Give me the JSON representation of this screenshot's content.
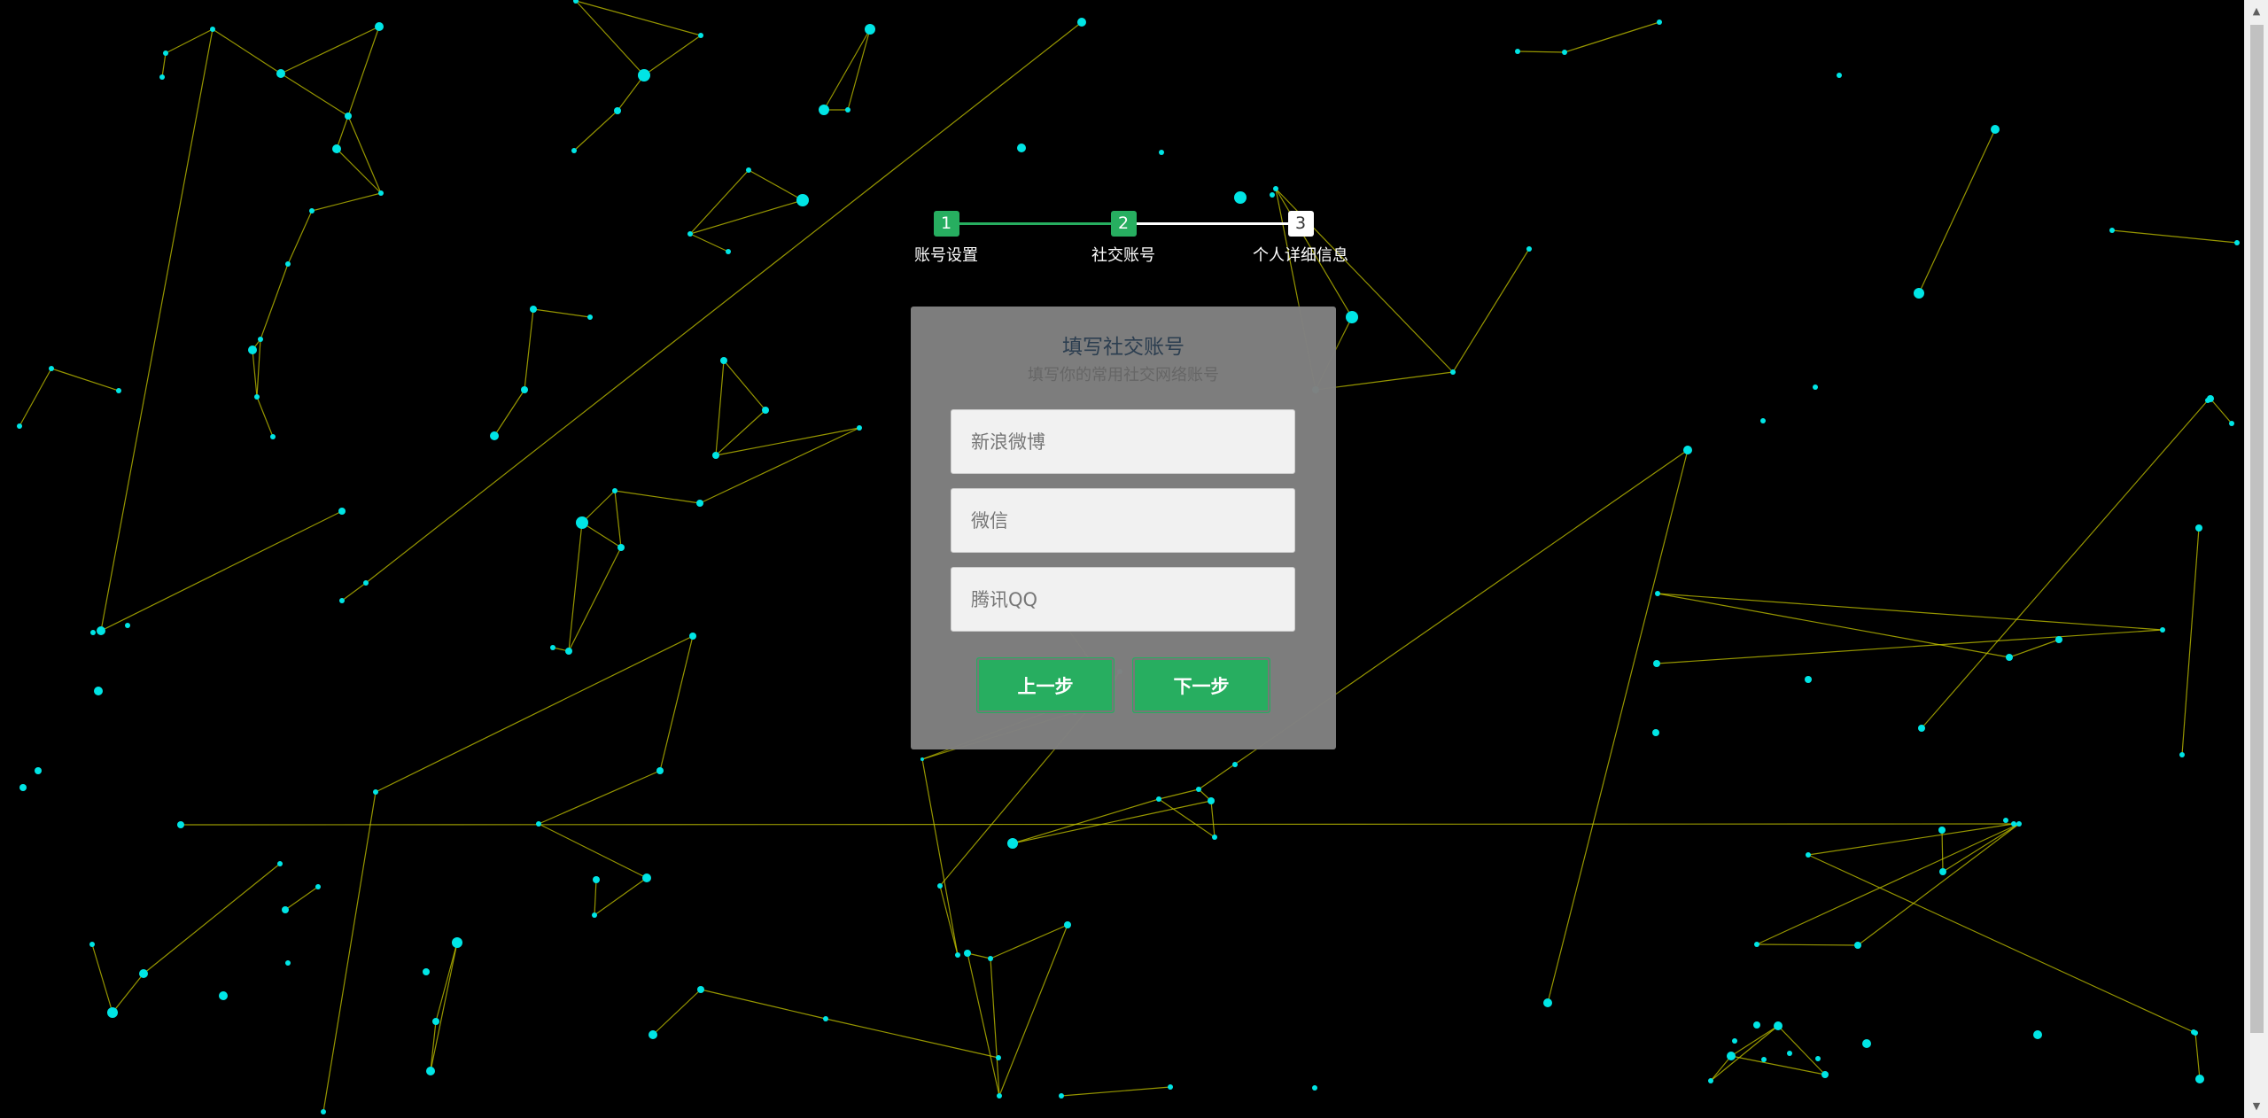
{
  "progress": {
    "steps": [
      {
        "number": "1",
        "label": "账号设置",
        "state": "active"
      },
      {
        "number": "2",
        "label": "社交账号",
        "state": "active"
      },
      {
        "number": "3",
        "label": "个人详细信息",
        "state": "inactive"
      }
    ]
  },
  "form": {
    "title": "填写社交账号",
    "subtitle": "填写你的常用社交网络账号",
    "fields": {
      "weibo": {
        "placeholder": "新浪微博",
        "value": ""
      },
      "wechat": {
        "placeholder": "微信",
        "value": ""
      },
      "qq": {
        "placeholder": "腾讯QQ",
        "value": ""
      }
    },
    "buttons": {
      "prev": "上一步",
      "next": "下一步"
    }
  },
  "scrollbar": {
    "up_icon": "▲",
    "down_icon": "▼"
  },
  "colors": {
    "background": "#000000",
    "accent": "#27ae60",
    "particle": "#00e5e5",
    "link": "#c8c800",
    "card": "#808080",
    "title": "#2c3e50"
  },
  "icons": {
    "scroll_up": "triangle-up-icon",
    "scroll_down": "triangle-down-icon"
  }
}
